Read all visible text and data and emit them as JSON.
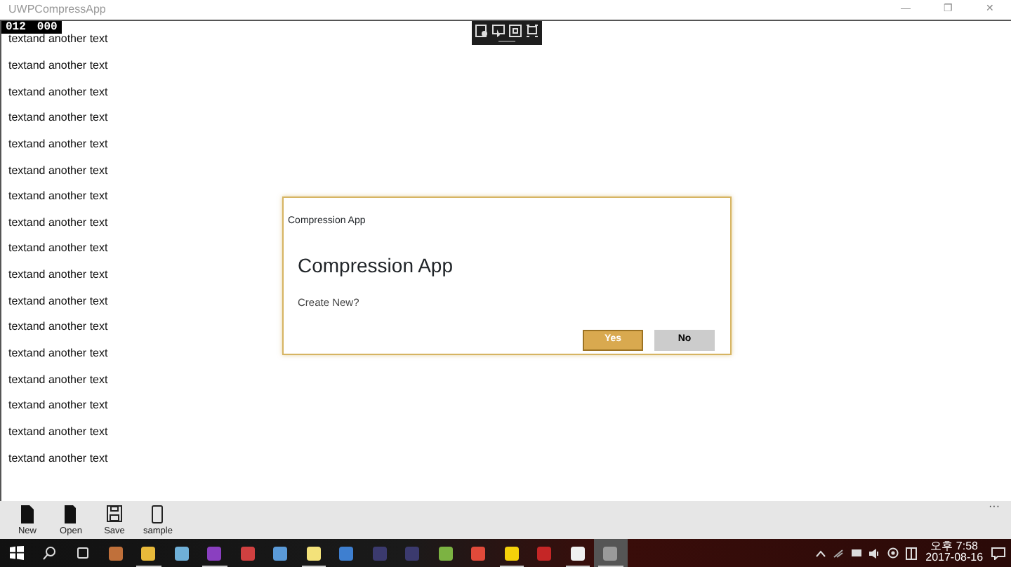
{
  "window": {
    "title": "UWPCompressApp",
    "controls": [
      "—",
      "❐",
      "✕"
    ]
  },
  "debug_counter": [
    "012",
    "000"
  ],
  "debug_toolbar": {
    "tools": [
      {
        "kind": "live-tree"
      },
      {
        "kind": "select"
      },
      {
        "kind": "layout"
      },
      {
        "kind": "track"
      }
    ]
  },
  "rows": [
    "textand another text",
    "textand another text",
    "textand another text",
    "textand another text",
    "textand another text",
    "textand another text",
    "textand another text",
    "textand another text",
    "textand another text",
    "textand another text",
    "textand another text",
    "textand another text",
    "textand another text",
    "textand another text",
    "textand another text",
    "textand another text",
    "textand another text"
  ],
  "dialog": {
    "window_title": "Compression App",
    "heading": "Compression App",
    "message": "Create New?",
    "buttons": [
      {
        "label": "Yes",
        "primary": true
      },
      {
        "label": "No",
        "primary": false
      }
    ]
  },
  "app_bar": {
    "buttons": [
      {
        "label": "New",
        "kind": "new"
      },
      {
        "label": "Open",
        "kind": "open"
      },
      {
        "label": "Save",
        "kind": "save"
      },
      {
        "label": "sample",
        "kind": "phone"
      }
    ],
    "more": "···"
  },
  "taskbar": {
    "apps": [
      {
        "color": "#c0703a",
        "open": false,
        "active": false
      },
      {
        "color": "#e8b93a",
        "open": true,
        "active": false
      },
      {
        "color": "#6fb0d8",
        "open": false,
        "active": false
      },
      {
        "color": "#8a3fc0",
        "open": true,
        "active": false
      },
      {
        "color": "#d04040",
        "open": false,
        "active": false
      },
      {
        "color": "#5a9ad8",
        "open": false,
        "active": false
      },
      {
        "color": "#f3e27a",
        "open": true,
        "active": false
      },
      {
        "color": "#3e7fd0",
        "open": false,
        "active": false
      },
      {
        "color": "#3b3a6e",
        "open": false,
        "active": false
      },
      {
        "color": "#3b3a6e",
        "open": false,
        "active": false
      },
      {
        "color": "#7cb342",
        "open": false,
        "active": false
      },
      {
        "color": "#e04a3a",
        "open": false,
        "active": false
      },
      {
        "color": "#f5d10a",
        "open": true,
        "active": false
      },
      {
        "color": "#c52626",
        "open": false,
        "active": false
      },
      {
        "color": "#f0f0f0",
        "open": true,
        "active": false
      },
      {
        "color": "#9a9a9a",
        "open": true,
        "active": true
      }
    ],
    "clock_time": "오후 7:58",
    "clock_date": "2017-08-16"
  }
}
